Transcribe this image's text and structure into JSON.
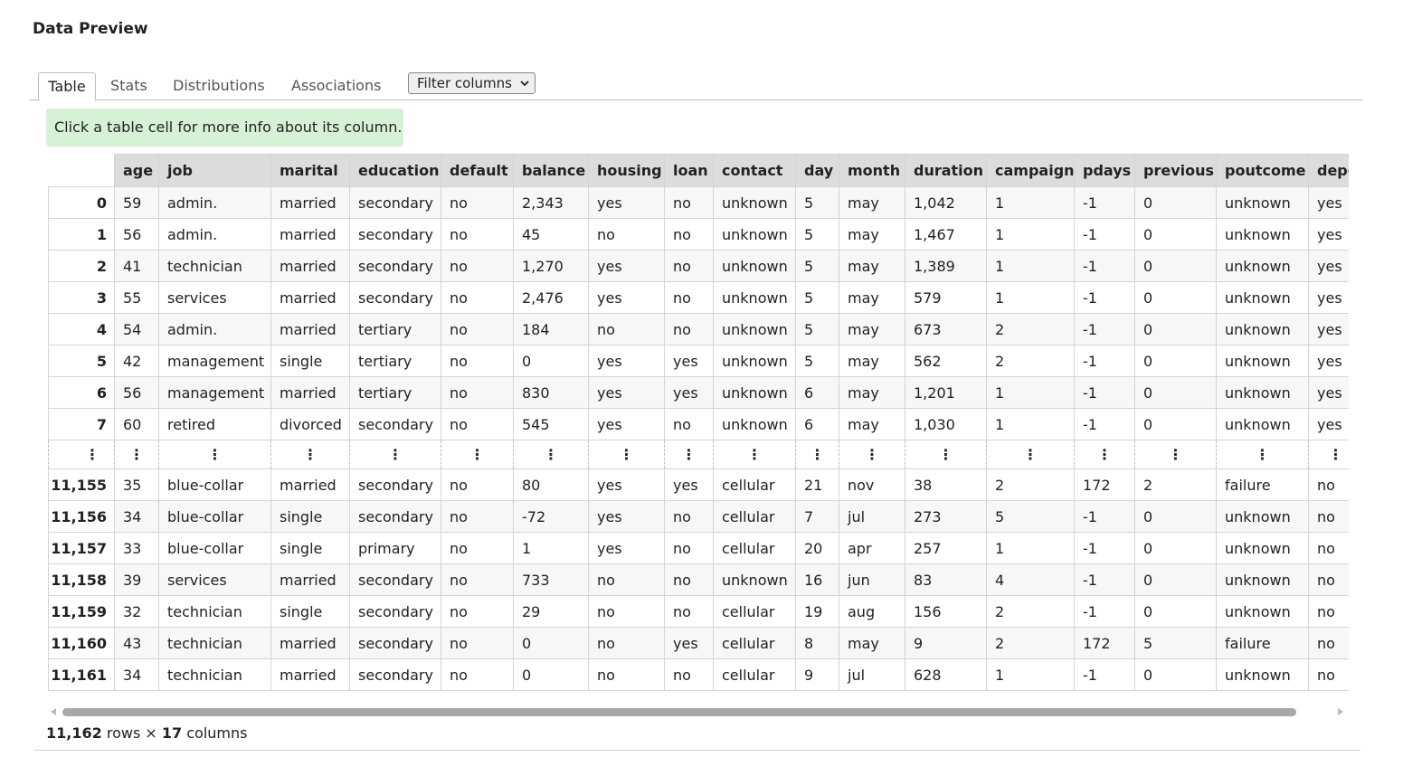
{
  "title": "Data Preview",
  "tabs": [
    {
      "label": "Table",
      "active": true
    },
    {
      "label": "Stats",
      "active": false
    },
    {
      "label": "Distributions",
      "active": false
    },
    {
      "label": "Associations",
      "active": false
    }
  ],
  "filter": {
    "label": "Filter columns",
    "icon": "chevron-down-icon"
  },
  "info_message": "Click a table cell for more info about its column.",
  "table": {
    "columns": [
      "age",
      "job",
      "marital",
      "education",
      "default",
      "balance",
      "housing",
      "loan",
      "contact",
      "day",
      "month",
      "duration",
      "campaign",
      "pdays",
      "previous",
      "poutcome",
      "deposit"
    ],
    "head_rows": [
      {
        "index": "0",
        "cells": [
          "59",
          "admin.",
          "married",
          "secondary",
          "no",
          "2,343",
          "yes",
          "no",
          "unknown",
          "5",
          "may",
          "1,042",
          "1",
          "-1",
          "0",
          "unknown",
          "yes"
        ]
      },
      {
        "index": "1",
        "cells": [
          "56",
          "admin.",
          "married",
          "secondary",
          "no",
          "45",
          "no",
          "no",
          "unknown",
          "5",
          "may",
          "1,467",
          "1",
          "-1",
          "0",
          "unknown",
          "yes"
        ]
      },
      {
        "index": "2",
        "cells": [
          "41",
          "technician",
          "married",
          "secondary",
          "no",
          "1,270",
          "yes",
          "no",
          "unknown",
          "5",
          "may",
          "1,389",
          "1",
          "-1",
          "0",
          "unknown",
          "yes"
        ]
      },
      {
        "index": "3",
        "cells": [
          "55",
          "services",
          "married",
          "secondary",
          "no",
          "2,476",
          "yes",
          "no",
          "unknown",
          "5",
          "may",
          "579",
          "1",
          "-1",
          "0",
          "unknown",
          "yes"
        ]
      },
      {
        "index": "4",
        "cells": [
          "54",
          "admin.",
          "married",
          "tertiary",
          "no",
          "184",
          "no",
          "no",
          "unknown",
          "5",
          "may",
          "673",
          "2",
          "-1",
          "0",
          "unknown",
          "yes"
        ]
      },
      {
        "index": "5",
        "cells": [
          "42",
          "management",
          "single",
          "tertiary",
          "no",
          "0",
          "yes",
          "yes",
          "unknown",
          "5",
          "may",
          "562",
          "2",
          "-1",
          "0",
          "unknown",
          "yes"
        ]
      },
      {
        "index": "6",
        "cells": [
          "56",
          "management",
          "married",
          "tertiary",
          "no",
          "830",
          "yes",
          "yes",
          "unknown",
          "6",
          "may",
          "1,201",
          "1",
          "-1",
          "0",
          "unknown",
          "yes"
        ]
      },
      {
        "index": "7",
        "cells": [
          "60",
          "retired",
          "divorced",
          "secondary",
          "no",
          "545",
          "yes",
          "no",
          "unknown",
          "6",
          "may",
          "1,030",
          "1",
          "-1",
          "0",
          "unknown",
          "yes"
        ]
      }
    ],
    "ellipsis": "⋮",
    "tail_rows": [
      {
        "index": "11,155",
        "cells": [
          "35",
          "blue-collar",
          "married",
          "secondary",
          "no",
          "80",
          "yes",
          "yes",
          "cellular",
          "21",
          "nov",
          "38",
          "2",
          "172",
          "2",
          "failure",
          "no"
        ]
      },
      {
        "index": "11,156",
        "cells": [
          "34",
          "blue-collar",
          "single",
          "secondary",
          "no",
          "-72",
          "yes",
          "no",
          "cellular",
          "7",
          "jul",
          "273",
          "5",
          "-1",
          "0",
          "unknown",
          "no"
        ]
      },
      {
        "index": "11,157",
        "cells": [
          "33",
          "blue-collar",
          "single",
          "primary",
          "no",
          "1",
          "yes",
          "no",
          "cellular",
          "20",
          "apr",
          "257",
          "1",
          "-1",
          "0",
          "unknown",
          "no"
        ]
      },
      {
        "index": "11,158",
        "cells": [
          "39",
          "services",
          "married",
          "secondary",
          "no",
          "733",
          "no",
          "no",
          "unknown",
          "16",
          "jun",
          "83",
          "4",
          "-1",
          "0",
          "unknown",
          "no"
        ]
      },
      {
        "index": "11,159",
        "cells": [
          "32",
          "technician",
          "single",
          "secondary",
          "no",
          "29",
          "no",
          "no",
          "cellular",
          "19",
          "aug",
          "156",
          "2",
          "-1",
          "0",
          "unknown",
          "no"
        ]
      },
      {
        "index": "11,160",
        "cells": [
          "43",
          "technician",
          "married",
          "secondary",
          "no",
          "0",
          "no",
          "yes",
          "cellular",
          "8",
          "may",
          "9",
          "2",
          "172",
          "5",
          "failure",
          "no"
        ]
      },
      {
        "index": "11,161",
        "cells": [
          "34",
          "technician",
          "married",
          "secondary",
          "no",
          "0",
          "no",
          "no",
          "cellular",
          "9",
          "jul",
          "628",
          "1",
          "-1",
          "0",
          "unknown",
          "no"
        ]
      }
    ]
  },
  "summary": {
    "rows": "11,162",
    "rows_label": "rows",
    "times": "×",
    "cols": "17",
    "cols_label": "columns"
  }
}
